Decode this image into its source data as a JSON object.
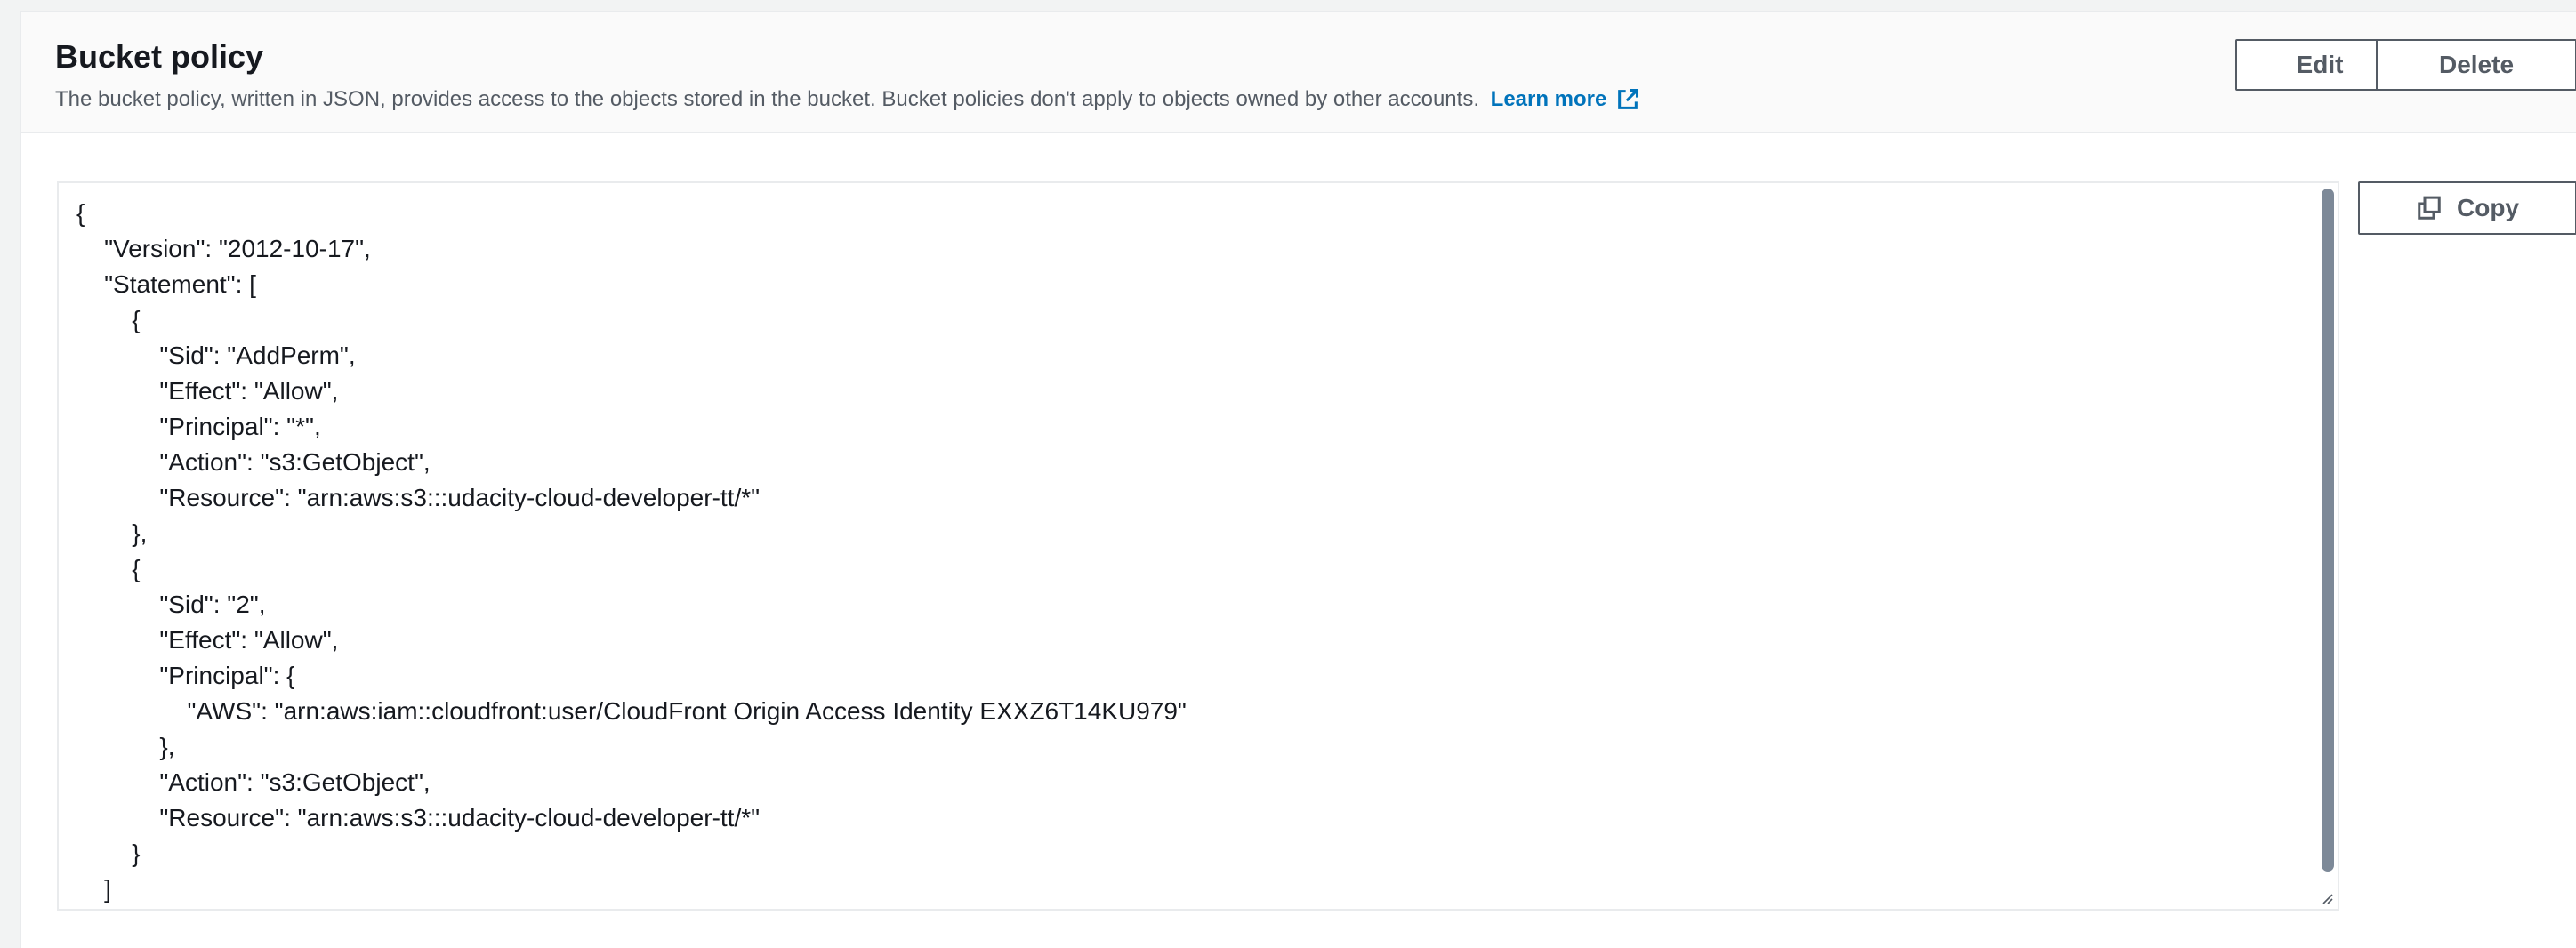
{
  "header": {
    "title": "Bucket policy",
    "description": "The bucket policy, written in JSON, provides access to the objects stored in the bucket. Bucket policies don't apply to objects owned by other accounts.",
    "learn_more": "Learn more",
    "learn_more_icon": "external-link-icon"
  },
  "actions": {
    "edit_label": "Edit",
    "delete_label": "Delete",
    "copy_label": "Copy",
    "copy_icon": "copy-icon"
  },
  "editor": {
    "lines": [
      "{",
      "    \"Version\": \"2012-10-17\",",
      "    \"Statement\": [",
      "        {",
      "            \"Sid\": \"AddPerm\",",
      "            \"Effect\": \"Allow\",",
      "            \"Principal\": \"*\",",
      "            \"Action\": \"s3:GetObject\",",
      "            \"Resource\": \"arn:aws:s3:::udacity-cloud-developer-tt/*\"",
      "        },",
      "        {",
      "            \"Sid\": \"2\",",
      "            \"Effect\": \"Allow\",",
      "            \"Principal\": {",
      "                \"AWS\": \"arn:aws:iam::cloudfront:user/CloudFront Origin Access Identity EXXZ6T14KU979\"",
      "            },",
      "            \"Action\": \"s3:GetObject\",",
      "            \"Resource\": \"arn:aws:s3:::udacity-cloud-developer-tt/*\"",
      "        }",
      "    ]"
    ]
  },
  "colors": {
    "link": "#0073bb",
    "text": "#16191f",
    "muted": "#545b64",
    "border": "#e9ebed",
    "scrollbar": "#7d8998"
  }
}
